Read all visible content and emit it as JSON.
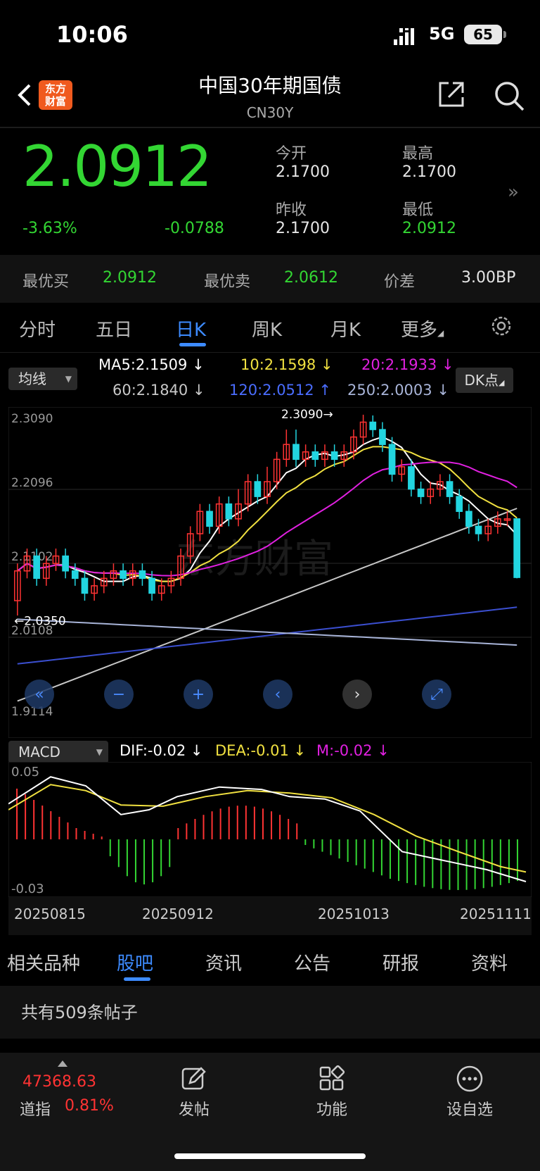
{
  "status_bar": {
    "time": "10:06",
    "network": "5G",
    "battery": "65"
  },
  "header": {
    "title": "中国30年期国债",
    "subtitle": "CN30Y",
    "logo_text_1": "东方",
    "logo_text_2": "财富"
  },
  "quote": {
    "price": "2.0912",
    "change_pct": "-3.63%",
    "change": "-0.0788",
    "open_label": "今开",
    "open": "2.1700",
    "high_label": "最高",
    "high": "2.1700",
    "prev_close_label": "昨收",
    "prev_close": "2.1700",
    "low_label": "最低",
    "low": "2.0912"
  },
  "best": {
    "bid_label": "最优买",
    "bid": "2.0912",
    "ask_label": "最优卖",
    "ask": "2.0612",
    "spread_label": "价差",
    "spread": "3.00BP"
  },
  "chart_tabs": [
    "分时",
    "五日",
    "日K",
    "周K",
    "月K",
    "更多"
  ],
  "chart_tab_active": "日K",
  "ma_panel": {
    "selector": "均线",
    "ma5": "MA5:2.1509",
    "ma10": "10:2.1598",
    "ma20": "20:2.1933",
    "ma60": "60:2.1840",
    "ma120": "120:2.0512",
    "ma250": "250:2.0003",
    "dk_button": "DK点",
    "colors": {
      "ma5": "#ffffff",
      "ma10": "#f0e040",
      "ma20": "#e020e0",
      "ma60": "#c8c8c8",
      "ma120": "#3b4fd0",
      "ma250": "#a8b4d8"
    }
  },
  "chart_data": {
    "type": "candlestick",
    "ylabels": [
      "2.3090",
      "2.2096",
      "2.1102",
      "2.0108",
      "1.9114"
    ],
    "ylim": [
      1.9114,
      2.309
    ],
    "annotations": [
      {
        "text": "2.3090→",
        "value": 2.309
      },
      {
        "text": "←2.0350",
        "value": 2.035
      }
    ],
    "xlabels": [
      "20250815",
      "20250912",
      "20251013",
      "20251111"
    ],
    "watermark": "东方财富",
    "candles": [
      [
        2.06,
        2.1,
        2.04,
        2.11
      ],
      [
        2.1,
        2.12,
        2.09,
        2.13
      ],
      [
        2.12,
        2.09,
        2.08,
        2.13
      ],
      [
        2.09,
        2.11,
        2.08,
        2.12
      ],
      [
        2.11,
        2.12,
        2.1,
        2.13
      ],
      [
        2.12,
        2.1,
        2.09,
        2.13
      ],
      [
        2.1,
        2.09,
        2.08,
        2.11
      ],
      [
        2.09,
        2.07,
        2.06,
        2.1
      ],
      [
        2.07,
        2.08,
        2.06,
        2.09
      ],
      [
        2.08,
        2.09,
        2.07,
        2.1
      ],
      [
        2.09,
        2.1,
        2.08,
        2.11
      ],
      [
        2.1,
        2.09,
        2.08,
        2.11
      ],
      [
        2.09,
        2.1,
        2.08,
        2.11
      ],
      [
        2.1,
        2.09,
        2.08,
        2.11
      ],
      [
        2.09,
        2.07,
        2.06,
        2.1
      ],
      [
        2.07,
        2.08,
        2.06,
        2.09
      ],
      [
        2.08,
        2.09,
        2.07,
        2.1
      ],
      [
        2.09,
        2.12,
        2.08,
        2.13
      ],
      [
        2.12,
        2.15,
        2.11,
        2.16
      ],
      [
        2.15,
        2.18,
        2.14,
        2.19
      ],
      [
        2.18,
        2.16,
        2.15,
        2.19
      ],
      [
        2.16,
        2.19,
        2.15,
        2.2
      ],
      [
        2.19,
        2.17,
        2.16,
        2.2
      ],
      [
        2.17,
        2.19,
        2.16,
        2.21
      ],
      [
        2.19,
        2.22,
        2.18,
        2.23
      ],
      [
        2.22,
        2.2,
        2.19,
        2.23
      ],
      [
        2.2,
        2.22,
        2.19,
        2.24
      ],
      [
        2.22,
        2.25,
        2.21,
        2.26
      ],
      [
        2.25,
        2.27,
        2.24,
        2.29
      ],
      [
        2.27,
        2.25,
        2.24,
        2.29
      ],
      [
        2.25,
        2.26,
        2.24,
        2.27
      ],
      [
        2.26,
        2.25,
        2.24,
        2.27
      ],
      [
        2.25,
        2.26,
        2.24,
        2.27
      ],
      [
        2.26,
        2.25,
        2.24,
        2.27
      ],
      [
        2.25,
        2.26,
        2.24,
        2.27
      ],
      [
        2.26,
        2.28,
        2.25,
        2.29
      ],
      [
        2.28,
        2.3,
        2.27,
        2.31
      ],
      [
        2.3,
        2.29,
        2.28,
        2.309
      ],
      [
        2.29,
        2.27,
        2.26,
        2.3
      ],
      [
        2.27,
        2.23,
        2.22,
        2.28
      ],
      [
        2.23,
        2.24,
        2.22,
        2.25
      ],
      [
        2.24,
        2.21,
        2.2,
        2.25
      ],
      [
        2.21,
        2.2,
        2.19,
        2.22
      ],
      [
        2.2,
        2.21,
        2.19,
        2.22
      ],
      [
        2.21,
        2.22,
        2.2,
        2.23
      ],
      [
        2.22,
        2.2,
        2.19,
        2.23
      ],
      [
        2.2,
        2.18,
        2.17,
        2.21
      ],
      [
        2.18,
        2.16,
        2.15,
        2.19
      ],
      [
        2.16,
        2.15,
        2.14,
        2.17
      ],
      [
        2.15,
        2.16,
        2.14,
        2.17
      ],
      [
        2.16,
        2.17,
        2.15,
        2.18
      ],
      [
        2.17,
        2.17,
        2.16,
        2.18
      ],
      [
        2.17,
        2.0912,
        2.09,
        2.17
      ]
    ]
  },
  "macd": {
    "selector": "MACD",
    "dif": "DIF:-0.02",
    "dea": "DEA:-0.01",
    "m": "M:-0.02",
    "top_label": "0.05",
    "bottom_label": "-0.03"
  },
  "bottom_tabs": [
    "相关品种",
    "股吧",
    "资讯",
    "公告",
    "研报",
    "资料"
  ],
  "bottom_tab_active": "股吧",
  "posts_summary": "共有509条帖子",
  "footer": {
    "index_value": "47368.63",
    "index_name": "道指",
    "index_change": "0.81%",
    "post": "发帖",
    "functions": "功能",
    "watchlist": "设自选"
  }
}
